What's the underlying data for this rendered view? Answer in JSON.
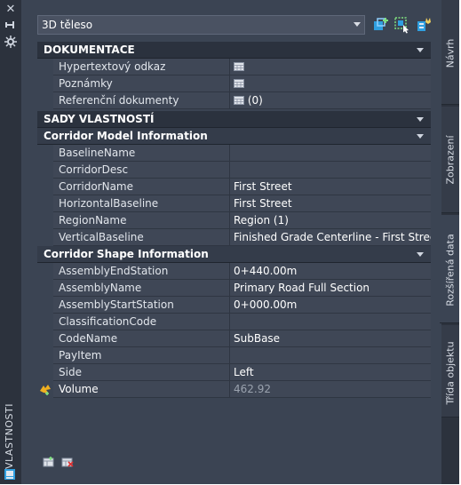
{
  "panel": {
    "vertical_title": "VLASTNOSTI",
    "selector_value": "3D těleso"
  },
  "sections": {
    "dokumentace": {
      "title": "DOKUMENTACE",
      "rows": [
        {
          "name": "Hypertextový odkaz",
          "value": "",
          "icon": "table-icon"
        },
        {
          "name": "Poznámky",
          "value": "",
          "icon": "table-icon"
        },
        {
          "name": "Referenční dokumenty",
          "value": "(0)",
          "icon": "table-icon"
        }
      ]
    },
    "sady": {
      "title": "SADY VLASTNOSTÍ"
    },
    "corridor_model": {
      "title": "Corridor Model Information",
      "rows": [
        {
          "name": "BaselineName",
          "value": ""
        },
        {
          "name": "CorridorDesc",
          "value": ""
        },
        {
          "name": "CorridorName",
          "value": "First Street"
        },
        {
          "name": "HorizontalBaseline",
          "value": "First Street"
        },
        {
          "name": "RegionName",
          "value": "Region (1)"
        },
        {
          "name": "VerticalBaseline",
          "value": "Finished Grade Centerline - First Street"
        }
      ]
    },
    "corridor_shape": {
      "title": "Corridor Shape Information",
      "rows": [
        {
          "name": "AssemblyEndStation",
          "value": "0+440.00m"
        },
        {
          "name": "AssemblyName",
          "value": "Primary Road Full Section"
        },
        {
          "name": "AssemblyStartStation",
          "value": "0+000.00m"
        },
        {
          "name": "ClassificationCode",
          "value": ""
        },
        {
          "name": "CodeName",
          "value": "SubBase"
        },
        {
          "name": "PayItem",
          "value": ""
        },
        {
          "name": "Side",
          "value": "Left"
        },
        {
          "name": "Volume",
          "value": "462.92"
        }
      ]
    }
  },
  "tabs": [
    {
      "label": "Návrh"
    },
    {
      "label": "Zobrazení"
    },
    {
      "label": "Rozšířená data"
    },
    {
      "label": "Třída objektu"
    }
  ],
  "colors": {
    "panel_bg": "#3b4453",
    "section_bg": "#2b323e",
    "row_bg": "#3f4756",
    "accent": "#2f9fe0"
  }
}
